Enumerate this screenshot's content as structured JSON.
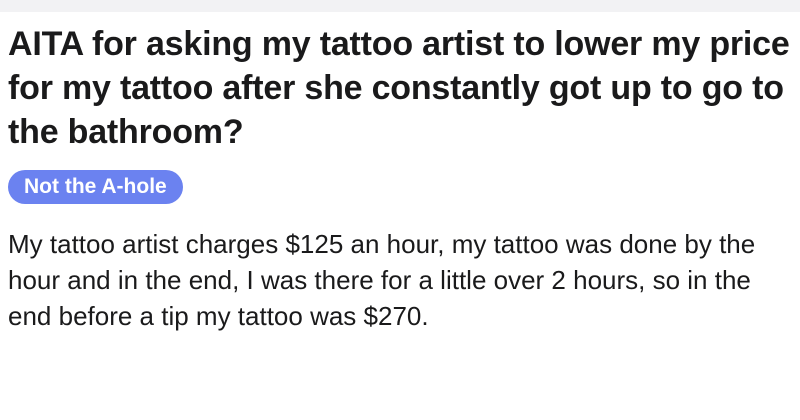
{
  "post": {
    "title": "AITA for asking my tattoo artist to lower my price for my tattoo after she constantly got up to go to the bathroom?",
    "flair": "Not the A-hole",
    "body": "My tattoo artist charges $125 an hour, my tattoo was done by the hour and in the end, I was there for a little over 2 hours, so in the end before a tip my tattoo was $270."
  },
  "colors": {
    "flair_background": "#6b82f0",
    "flair_text": "#ffffff",
    "text": "#1a1a1b",
    "top_strip": "#f2f2f4"
  }
}
